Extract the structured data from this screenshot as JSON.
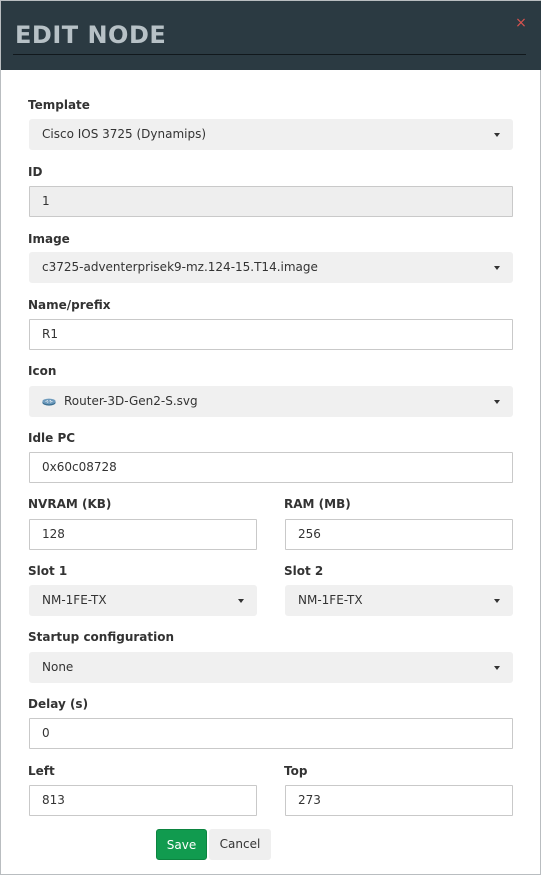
{
  "modal": {
    "title": "EDIT NODE",
    "close_icon": "close-icon",
    "close_glyph": "×"
  },
  "fields": {
    "template": {
      "label": "Template",
      "value": "Cisco IOS 3725 (Dynamips)"
    },
    "id": {
      "label": "ID",
      "value": "1"
    },
    "image": {
      "label": "Image",
      "value": "c3725-adventerprisek9-mz.124-15.T14.image"
    },
    "name_prefix": {
      "label": "Name/prefix",
      "value": "R1"
    },
    "icon": {
      "label": "Icon",
      "value": "Router-3D-Gen2-S.svg",
      "icon": "router-icon"
    },
    "idle_pc": {
      "label": "Idle PC",
      "value": "0x60c08728"
    },
    "nvram": {
      "label": "NVRAM (KB)",
      "value": "128"
    },
    "ram": {
      "label": "RAM (MB)",
      "value": "256"
    },
    "slot1": {
      "label": "Slot 1",
      "value": "NM-1FE-TX"
    },
    "slot2": {
      "label": "Slot 2",
      "value": "NM-1FE-TX"
    },
    "startup_config": {
      "label": "Startup configuration",
      "value": "None"
    },
    "delay": {
      "label": "Delay (s)",
      "value": "0"
    },
    "left": {
      "label": "Left",
      "value": "813"
    },
    "top": {
      "label": "Top",
      "value": "273"
    }
  },
  "buttons": {
    "save_label": "Save",
    "cancel_label": "Cancel"
  },
  "colors": {
    "header_bg": "#2b3a42",
    "title_color": "#b7c1c6",
    "close_color": "#d9534f",
    "save_bg": "#119b4f",
    "cancel_bg": "#efefef",
    "select_bg": "#f0f0f0",
    "readonly_bg": "#eeeeee"
  }
}
